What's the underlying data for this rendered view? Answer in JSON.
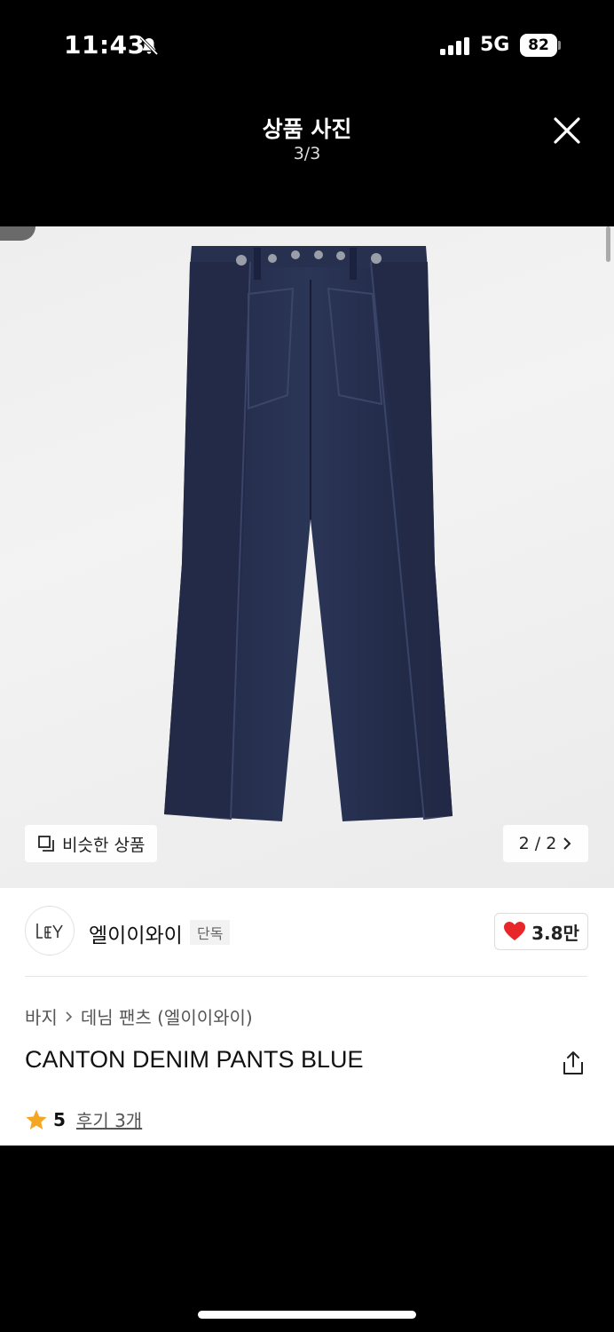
{
  "status_bar": {
    "time": "11:43",
    "network": "5G",
    "battery": "82",
    "icons": [
      "bell-slash-icon",
      "signal-bars-icon",
      "battery-icon"
    ]
  },
  "viewer": {
    "title": "상품 사진",
    "counter": "3/3",
    "close_icon": "close-icon"
  },
  "photo": {
    "similar_button_label": "비슷한 상품",
    "pager_label": "2 / 2",
    "pager_icon": "chevron-right-icon"
  },
  "brand": {
    "name": "엘이이와이",
    "badge": "단독",
    "like_count": "3.8만",
    "like_icon": "heart-icon",
    "like_color": "#e8272b"
  },
  "product": {
    "breadcrumb": [
      "바지",
      "데님 팬츠 (엘이이와이)"
    ],
    "title": "CANTON DENIM PANTS BLUE",
    "share_icon": "share-icon",
    "rating": "5",
    "reviews_label": "후기 3개",
    "star_color": "#f5a623"
  }
}
